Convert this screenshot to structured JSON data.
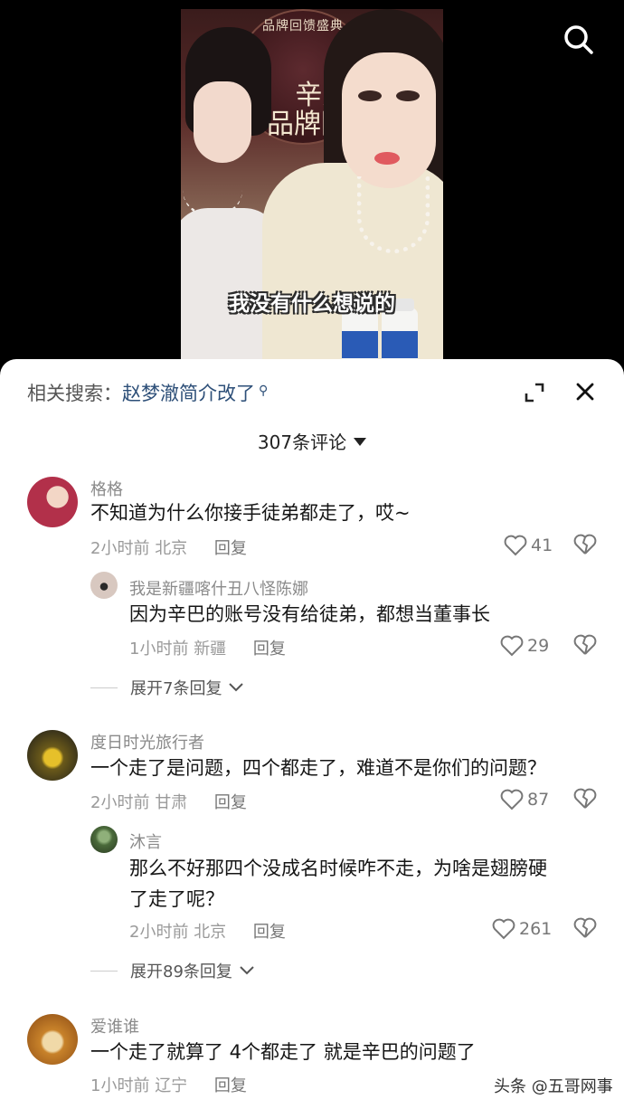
{
  "video": {
    "banner_top": "品牌回馈盛典",
    "banner_main_line1": "辛选618",
    "banner_main_line2": "品牌回馈盛典",
    "subtitle": "我没有什么想说的",
    "search_icon": "search-icon"
  },
  "sheet": {
    "related_label": "相关搜索：",
    "related_query": "赵梦澈简介改了",
    "comment_count": "307条评论",
    "expand_icon": "expand-icon",
    "close_icon": "close-icon"
  },
  "comments": [
    {
      "name": "格格",
      "text": "不知道为什么你接手徒弟都走了，哎~",
      "time": "2小时前",
      "location": "北京",
      "reply_label": "回复",
      "likes": "41",
      "avatar_color": "#b2304a"
    },
    {
      "name": "我是新疆喀什丑八怪陈娜",
      "text": "因为辛巴的账号没有给徒弟，都想当董事长",
      "time": "1小时前",
      "location": "新疆",
      "reply_label": "回复",
      "likes": "29",
      "avatar_color": "#d8c8c0"
    },
    {
      "expand_label": "展开7条回复"
    },
    {
      "name": "度日时光旅行者",
      "text": "一个走了是问题，四个都走了，难道不是你们的问题？",
      "time": "2小时前",
      "location": "甘肃",
      "reply_label": "回复",
      "likes": "87",
      "avatar_color": "#6b5a1a"
    },
    {
      "name": "沐言",
      "text_line1": "那么不好那四个没成名时候咋不走，为啥是翅膀硬",
      "text_line2": "了走了呢？",
      "time": "2小时前",
      "location": "北京",
      "reply_label": "回复",
      "likes": "261",
      "avatar_color": "#4a6a3a"
    },
    {
      "expand_label": "展开89条回复"
    },
    {
      "name": "爱谁谁",
      "text": "一个走了就算了 4个都走了 就是辛巴的问题了",
      "time": "1小时前",
      "location": "辽宁",
      "reply_label": "回复",
      "avatar_color": "#c8822a"
    }
  ],
  "watermark": "头条 @五哥网事"
}
